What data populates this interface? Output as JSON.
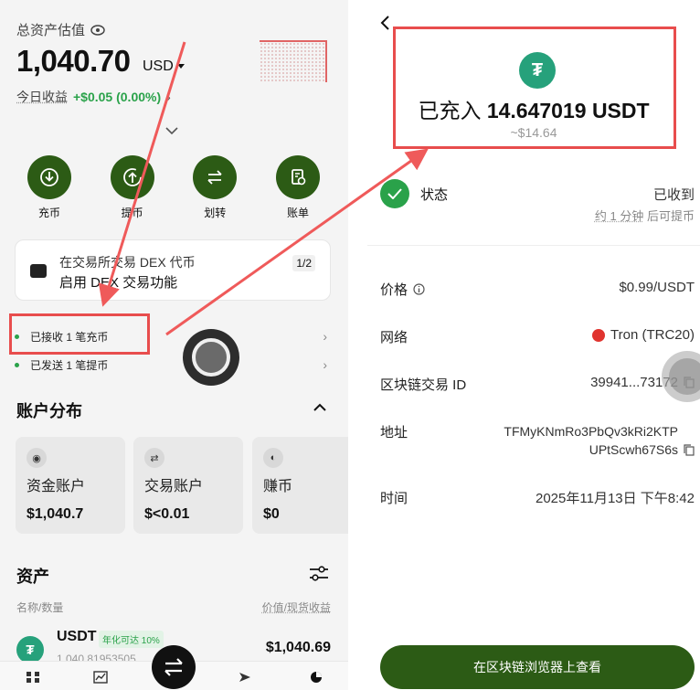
{
  "left": {
    "total_label": "总资产估值",
    "total_value": "1,040.70",
    "total_unit": "USD",
    "today_label": "今日收益",
    "today_value": "+$0.05 (0.00%)",
    "actions": [
      {
        "label": "充币",
        "icon": "deposit-icon"
      },
      {
        "label": "提币",
        "icon": "withdraw-icon"
      },
      {
        "label": "划转",
        "icon": "transfer-icon"
      },
      {
        "label": "账单",
        "icon": "bill-icon"
      }
    ],
    "dex_card": {
      "line1": "在交易所交易 DEX 代币",
      "line2": "启用 DEX 交易功能",
      "pager": "1/2"
    },
    "notices": [
      "已接收 1 笔充币",
      "已发送 1 笔提币"
    ],
    "distribution_title": "账户分布",
    "accounts": [
      {
        "name": "资金账户",
        "value": "$1,040.7",
        "icon": "fund-icon"
      },
      {
        "name": "交易账户",
        "value": "$<0.01",
        "icon": "trade-icon"
      },
      {
        "name": "赚币",
        "value": "$0",
        "icon": "earn-icon"
      }
    ],
    "assets_title": "资产",
    "col_left": "名称/数量",
    "col_right": "价值/现货收益",
    "asset": {
      "symbol": "USDT",
      "badge": "年化可达 10%",
      "amount": "1,040.81953505",
      "value": "$1,040.69"
    }
  },
  "right": {
    "title_prefix": "已充入",
    "title_amount": "14.647019 USDT",
    "subtitle": "~$14.64",
    "status_label": "状态",
    "status_value": "已收到",
    "status_sub_u": "约 1 分钟",
    "status_sub_rest": " 后可提币",
    "price_label": "价格",
    "price_value": "$0.99/USDT",
    "network_label": "网络",
    "network_value": "Tron (TRC20)",
    "txid_label": "区块链交易 ID",
    "txid_value": "39941...73172",
    "address_label": "地址",
    "address_line1": "TFMyKNmRo3PbQv3kRi2KTP",
    "address_line2": "UPtScwh67S6s",
    "time_label": "时间",
    "time_value": "2025年11月13日 下午8:42",
    "explorer_button": "在区块链浏览器上查看"
  },
  "colors": {
    "brand_green": "#2c5b15",
    "positive": "#2aa24a",
    "usdt": "#26a17b",
    "tron": "#e0342f",
    "annotation_red": "#e84d4d"
  }
}
